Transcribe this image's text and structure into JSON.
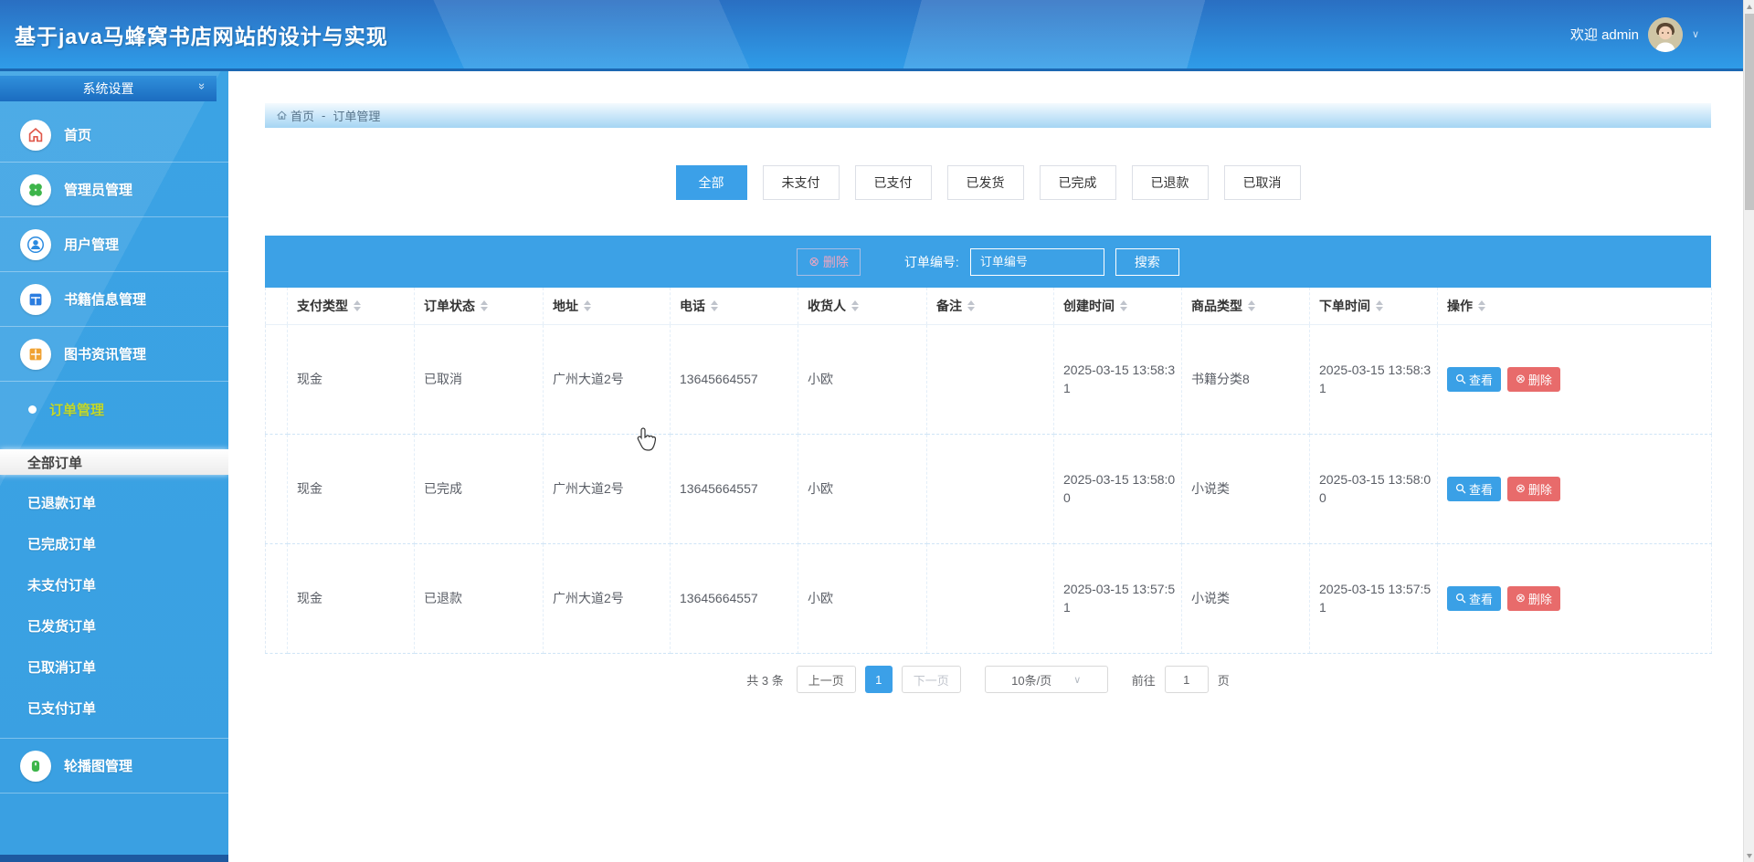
{
  "header": {
    "title": "基于java马蜂窝书店网站的设计与实现",
    "welcome": "欢迎 admin"
  },
  "sidebar": {
    "panel_title": "系统设置",
    "items": [
      {
        "label": "首页"
      },
      {
        "label": "管理员管理"
      },
      {
        "label": "用户管理"
      },
      {
        "label": "书籍信息管理"
      },
      {
        "label": "图书资讯管理"
      },
      {
        "label": "订单管理"
      },
      {
        "label": "轮播图管理"
      }
    ],
    "sub_items": [
      {
        "label": "全部订单"
      },
      {
        "label": "已退款订单"
      },
      {
        "label": "已完成订单"
      },
      {
        "label": "未支付订单"
      },
      {
        "label": "已发货订单"
      },
      {
        "label": "已取消订单"
      },
      {
        "label": "已支付订单"
      }
    ]
  },
  "breadcrumb": {
    "home": "首页",
    "separator": "-",
    "current": "订单管理"
  },
  "tabs": [
    {
      "label": "全部"
    },
    {
      "label": "未支付"
    },
    {
      "label": "已支付"
    },
    {
      "label": "已发货"
    },
    {
      "label": "已完成"
    },
    {
      "label": "已退款"
    },
    {
      "label": "已取消"
    }
  ],
  "toolbar": {
    "delete_label": "删除",
    "order_no_label": "订单编号:",
    "search_placeholder": "订单编号",
    "search_label": "搜索"
  },
  "table": {
    "columns": [
      "支付类型",
      "订单状态",
      "地址",
      "电话",
      "收货人",
      "备注",
      "创建时间",
      "商品类型",
      "下单时间",
      "操作"
    ],
    "actions": {
      "view": "查看",
      "delete": "删除"
    },
    "rows": [
      {
        "cells": [
          "现金",
          "已取消",
          "广州大道2号",
          "13645664557",
          "小欧",
          "",
          "2025-03-15 13:58:31",
          "书籍分类8",
          "2025-03-15 13:58:31"
        ]
      },
      {
        "cells": [
          "现金",
          "已完成",
          "广州大道2号",
          "13645664557",
          "小欧",
          "",
          "2025-03-15 13:58:00",
          "小说类",
          "2025-03-15 13:58:00"
        ]
      },
      {
        "cells": [
          "现金",
          "已退款",
          "广州大道2号",
          "13645664557",
          "小欧",
          "",
          "2025-03-15 13:57:51",
          "小说类",
          "2025-03-15 13:57:51"
        ]
      }
    ]
  },
  "pagination": {
    "total": "共 3 条",
    "prev": "上一页",
    "page": "1",
    "next": "下一页",
    "page_size": "10条/页",
    "goto_label": "前往",
    "goto_value": "1",
    "unit": "页"
  },
  "colors": {
    "accent_blue": "#3ba0e8",
    "toolbar_blue": "#3ca1e6",
    "sidebar_blue": "#3ba3e4",
    "active_menu_text": "#c3d829",
    "danger_red": "#e86b6b"
  }
}
